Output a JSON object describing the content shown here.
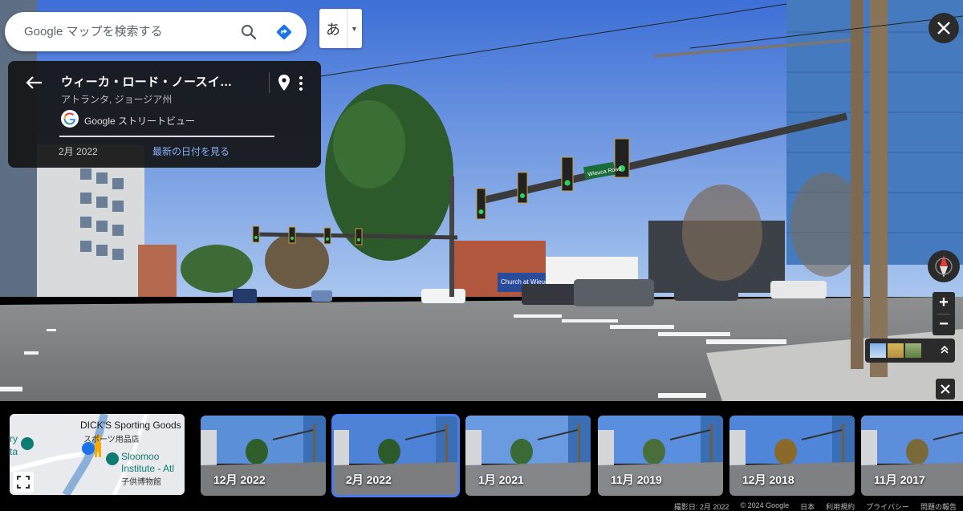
{
  "search": {
    "placeholder": "Google マップを検索する"
  },
  "ime": {
    "char": "あ",
    "dropdown": "▼"
  },
  "place": {
    "title": "ウィーカ・ロード・ノースイ…",
    "subtitle": "アトランタ, ジョージア州",
    "source": "Google ストリートビュー",
    "date": "2月 2022",
    "latest_link": "最新の日付を見る"
  },
  "streetview": {
    "sign_street": "Wieuca Road",
    "sign_church": "Church at Wieuca"
  },
  "zoom": {
    "in": "+",
    "out": "−"
  },
  "minimap": {
    "label_store": "DICK'S Sporting Goods",
    "label_store_jp": "スポーツ用品店",
    "label_museum": "Sloomoo",
    "label_museum2": "Institute - Atl",
    "label_museum_jp": "子供博物館",
    "label_left1": "ry",
    "label_left2": "ta"
  },
  "timeline": [
    {
      "label": "12月 2022",
      "selected": false
    },
    {
      "label": "2月 2022",
      "selected": true
    },
    {
      "label": "1月 2021",
      "selected": false
    },
    {
      "label": "11月 2019",
      "selected": false
    },
    {
      "label": "12月 2018",
      "selected": false
    },
    {
      "label": "11月 2017",
      "selected": false
    }
  ],
  "footer": {
    "capture_date": "撮影日: 2月 2022",
    "copyright": "© 2024 Google",
    "country": "日本",
    "terms": "利用規約",
    "privacy": "プライバシー",
    "report": "問題の報告"
  },
  "colors": {
    "accent": "#4a7cf0",
    "link": "#8ab4f8",
    "card_bg": "#141414"
  }
}
